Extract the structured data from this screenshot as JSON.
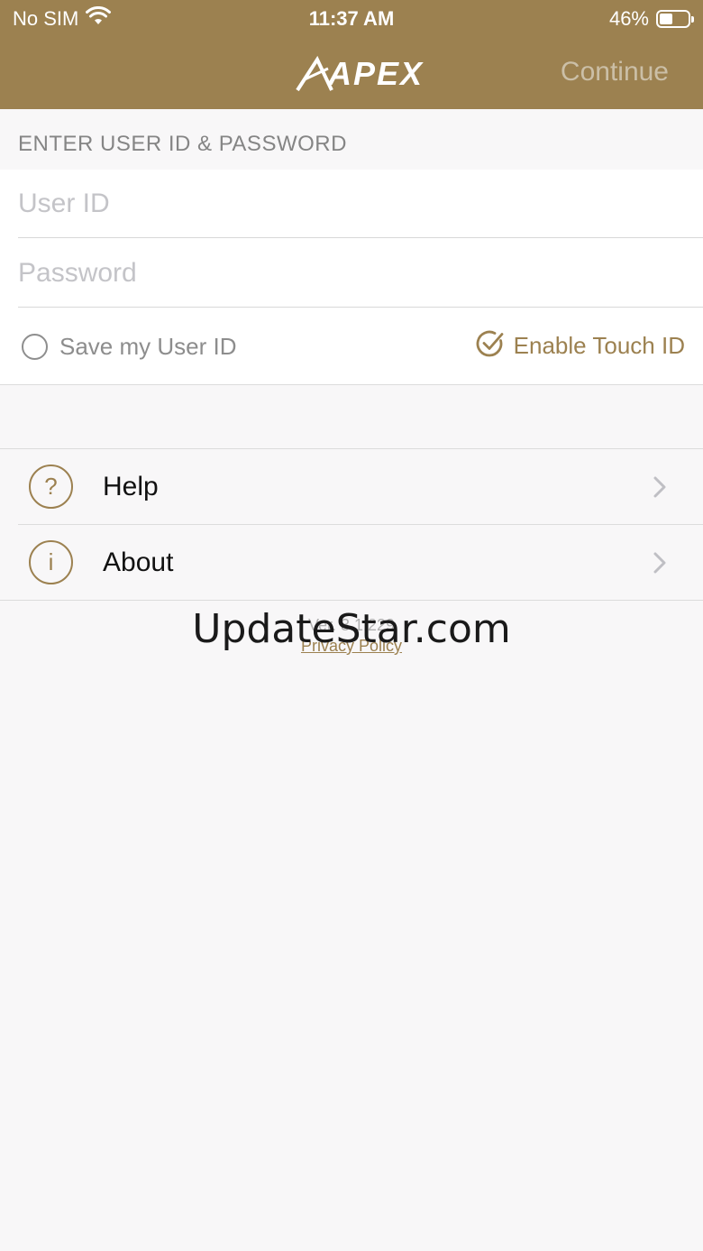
{
  "status_bar": {
    "carrier": "No SIM",
    "time": "11:37 AM",
    "battery": "46%",
    "battery_level": 0.46,
    "icons": [
      "wifi-icon",
      "battery-icon"
    ]
  },
  "nav": {
    "logo_text": "APEX",
    "continue_label": "Continue"
  },
  "login": {
    "heading": "ENTER USER ID & PASSWORD",
    "user_id_placeholder": "User ID",
    "password_placeholder": "Password",
    "save_user_id_label": "Save my User ID",
    "enable_touch_id_label": "Enable Touch ID"
  },
  "menu": {
    "items": [
      {
        "label": "Help",
        "icon_glyph": "?",
        "icon": "help-icon"
      },
      {
        "label": "About",
        "icon_glyph": "i",
        "icon": "info-icon"
      }
    ]
  },
  "footer": {
    "version": "Ver. 3.1.229",
    "privacy_label": "Privacy Policy"
  },
  "watermark": "UpdateStar.com",
  "colors": {
    "brand": "#9c8150",
    "continue_disabled": "#cbbfa7",
    "background": "#f8f7f8"
  }
}
